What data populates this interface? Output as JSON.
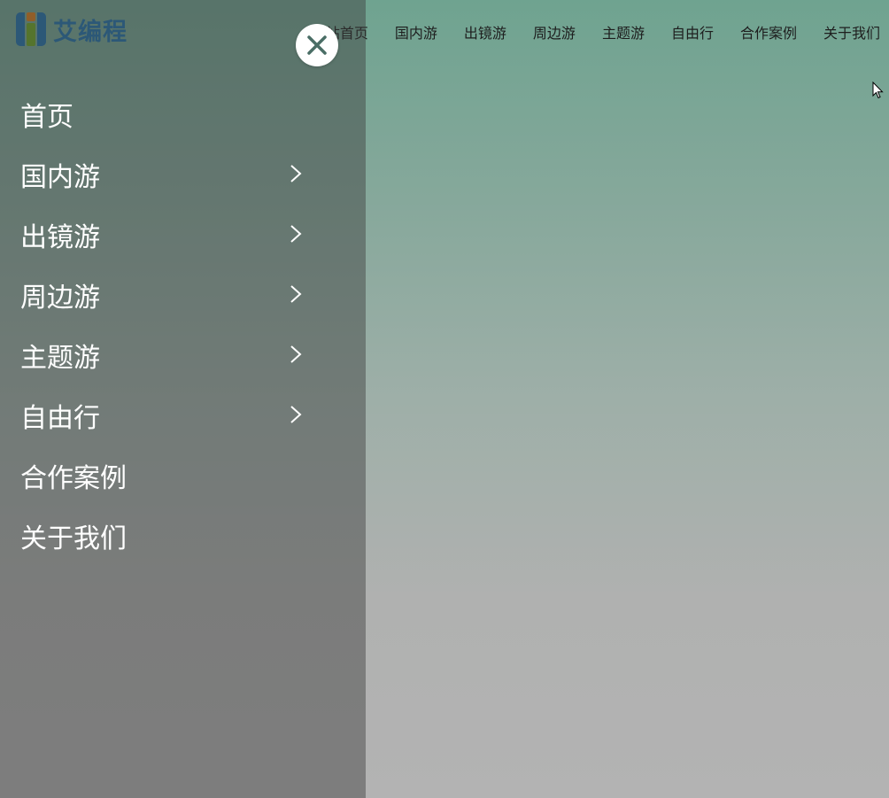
{
  "logo": {
    "text": "艾编程",
    "icon": "logo-icon"
  },
  "topnav": {
    "items": [
      "网站首页",
      "国内游",
      "出镜游",
      "周边游",
      "主题游",
      "自由行",
      "合作案例",
      "关于我们"
    ]
  },
  "drawer": {
    "items": [
      {
        "label": "首页",
        "has_submenu": false
      },
      {
        "label": "国内游",
        "has_submenu": true
      },
      {
        "label": "出镜游",
        "has_submenu": true
      },
      {
        "label": "周边游",
        "has_submenu": true
      },
      {
        "label": "主题游",
        "has_submenu": true
      },
      {
        "label": "自由行",
        "has_submenu": true
      },
      {
        "label": "合作案例",
        "has_submenu": false
      },
      {
        "label": "关于我们",
        "has_submenu": false
      }
    ],
    "close_icon": "close-icon",
    "submenu_icon": "chevron-right-icon"
  },
  "colors": {
    "brand": "#1f6fa8",
    "overlay": "#3c3c3c",
    "drawer_text": "#ffffff",
    "nav_text": "#1e1e1e"
  }
}
